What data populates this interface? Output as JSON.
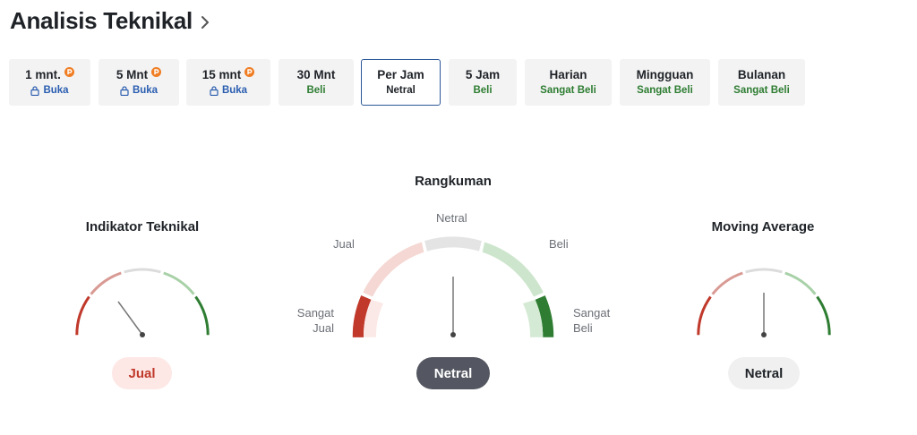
{
  "header": {
    "title": "Analisis Teknikal"
  },
  "tabs": [
    {
      "label": "1 mnt.",
      "status": "Buka",
      "pro": true
    },
    {
      "label": "5 Mnt",
      "status": "Buka",
      "pro": true
    },
    {
      "label": "15 mnt",
      "status": "Buka",
      "pro": true
    },
    {
      "label": "30 Mnt",
      "status": "Beli"
    },
    {
      "label": "Per Jam",
      "status": "Netral",
      "selected": true
    },
    {
      "label": "5 Jam",
      "status": "Beli"
    },
    {
      "label": "Harian",
      "status": "Sangat Beli"
    },
    {
      "label": "Mingguan",
      "status": "Sangat Beli"
    },
    {
      "label": "Bulanan",
      "status": "Sangat Beli"
    }
  ],
  "gauges": {
    "indicators": {
      "title": "Indikator Teknikal",
      "result": "Jual"
    },
    "summary": {
      "title": "Rangkuman",
      "result": "Netral",
      "labels": {
        "strong_sell_1": "Sangat",
        "strong_sell_2": "Jual",
        "sell": "Jual",
        "neutral": "Netral",
        "buy": "Beli",
        "strong_buy_1": "Sangat",
        "strong_buy_2": "Beli"
      }
    },
    "moving_average": {
      "title": "Moving Average",
      "result": "Netral"
    }
  },
  "colors": {
    "strong_sell": "#c0392b",
    "sell": "#d99a94",
    "neutral": "#d9d9d9",
    "buy": "#a8d1a8",
    "strong_buy": "#2e7d32",
    "selected_border": "#2b5797",
    "pill_sell_bg": "#fde8e6",
    "pill_neutral_dark": "#545761",
    "pill_neutral_light": "#f0f0f0"
  },
  "icons": {
    "header_chevron": "chevron-right-icon",
    "pro": "pro-badge-icon",
    "lock": "lock-icon"
  }
}
